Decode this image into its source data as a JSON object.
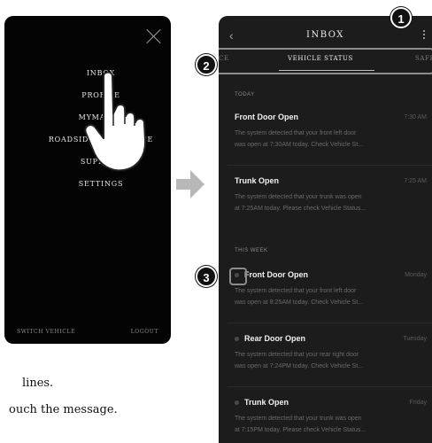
{
  "menu": {
    "items": [
      "INBOX",
      "PROFILE",
      "MYMAZDA",
      "ROADSIDE ASSISTANCE",
      "SUPPORT",
      "SETTINGS"
    ],
    "footer_left": "SWITCH VEHICLE",
    "footer_right": "LOGOUT"
  },
  "inbox": {
    "title": "INBOX",
    "tabs": [
      "CE",
      "VEHICLE STATUS",
      "SAFE"
    ],
    "active_tab": "VEHICLE STATUS",
    "sections": {
      "today": "TODAY",
      "this_week": "THIS WEEK"
    },
    "messages": [
      {
        "title": "Front Door Open",
        "time": "7:30 AM",
        "line1": "The system detected that your front left door",
        "line2": "was open at 7:30AM today. Check Vehicle St...",
        "unread": false
      },
      {
        "title": "Trunk Open",
        "time": "7:25 AM",
        "line1": "The system detected that your trunk was open",
        "line2": "at 7:25AM today. Please check Vehicle Status...",
        "unread": false
      },
      {
        "title": "Front Door Open",
        "time": "Monday",
        "line1": "The system detected that your front left door",
        "line2": "was open at 8:25AM today. Check Vehicle St...",
        "unread": true
      },
      {
        "title": "Rear Door Open",
        "time": "Tuesday",
        "line1": "The system detected that your rear right door",
        "line2": "was open at 7:24PM today. Check Vehicle St...",
        "unread": true
      },
      {
        "title": "Trunk Open",
        "time": "Friday",
        "line1": "The system detected that your trunk was open",
        "line2": "at 7:15PM today. Please check Vehicle Status...",
        "unread": true
      }
    ]
  },
  "callouts": [
    "1",
    "2",
    "3"
  ],
  "captions": [
    "lines.",
    "ouch the message."
  ],
  "icons": [
    "close-icon",
    "back-icon",
    "more-options-icon",
    "hand-pointer-icon",
    "right-arrow-icon",
    "unread-dot-icon"
  ]
}
